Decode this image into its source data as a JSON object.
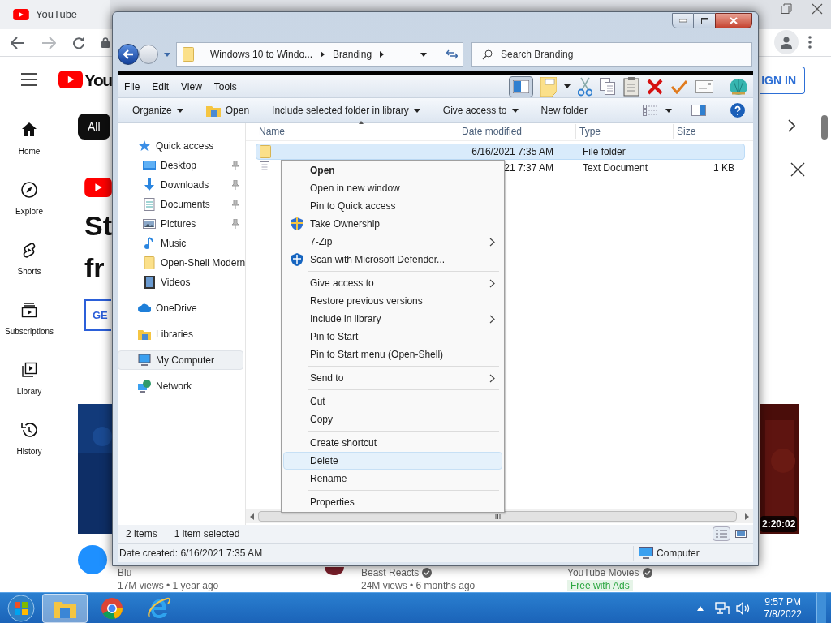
{
  "browser": {
    "tab": {
      "title": "YouTube"
    },
    "logo": "You",
    "rail": [
      {
        "label": "Home"
      },
      {
        "label": "Explore"
      },
      {
        "label": "Shorts"
      },
      {
        "label": "Subscriptions"
      },
      {
        "label": "Library"
      },
      {
        "label": "History"
      }
    ],
    "chips": [
      {
        "label": "All",
        "selected": true
      }
    ],
    "banner": {
      "line_1": "St",
      "line_2": "fr",
      "button": "GE"
    },
    "sign_in": "IGN IN",
    "duration": "2:20:02",
    "videos": [
      {
        "channel": "Blu",
        "verified": false,
        "meta": "17M views • 1 year ago"
      },
      {
        "channel": "Beast Reacts",
        "verified": true,
        "meta": "24M views • 6 months ago"
      },
      {
        "channel": "YouTube Movies",
        "verified": true,
        "badge": "Free with Ads"
      }
    ]
  },
  "explorer": {
    "address": [
      "Windows 10 to Windo...",
      "Branding"
    ],
    "search": {
      "placeholder": "Search Branding"
    },
    "menu": [
      "File",
      "Edit",
      "View",
      "Tools"
    ],
    "commands": [
      {
        "label": "Organize",
        "dropdown": true
      },
      {
        "label": "Open",
        "dropdown": false
      },
      {
        "label": "Include selected folder in library",
        "dropdown": true
      },
      {
        "label": "Give access to",
        "dropdown": true
      },
      {
        "label": "New folder",
        "dropdown": false
      }
    ],
    "nav": [
      {
        "label": "Quick access",
        "selected": false,
        "children": [
          {
            "label": "Desktop",
            "pinned": true,
            "selected": false
          },
          {
            "label": "Downloads",
            "pinned": true,
            "selected": false
          },
          {
            "label": "Documents",
            "pinned": true,
            "selected": false
          },
          {
            "label": "Pictures",
            "pinned": true,
            "selected": false
          },
          {
            "label": "Music",
            "pinned": false,
            "selected": false
          },
          {
            "label": "Open-Shell Modern",
            "pinned": false,
            "selected": false
          },
          {
            "label": "Videos",
            "pinned": false,
            "selected": false
          }
        ]
      },
      {
        "label": "OneDrive",
        "selected": false
      },
      {
        "label": "Libraries",
        "selected": false
      },
      {
        "label": "My Computer",
        "selected": true
      },
      {
        "label": "Network",
        "selected": false
      }
    ],
    "columns": [
      "Name",
      "Date modified",
      "Type",
      "Size"
    ],
    "rows": [
      {
        "selected": true,
        "date": "6/16/2021 7:35 AM",
        "type": "File folder"
      },
      {
        "selected": false,
        "date": "21 7:37 AM",
        "type": "Text Document",
        "size": "1 KB"
      }
    ],
    "status": {
      "count": "2 items",
      "selection": "1 item selected"
    },
    "details": {
      "text": "Date created: 6/16/2021 7:35 AM",
      "location": "Computer"
    }
  },
  "context_menu": [
    {
      "kind": "item",
      "label": "Open",
      "bold": true,
      "selected": false
    },
    {
      "kind": "item",
      "label": "Open in new window",
      "selected": false
    },
    {
      "kind": "item",
      "label": "Pin to Quick access",
      "selected": false
    },
    {
      "kind": "item",
      "label": "Take Ownership",
      "selected": false
    },
    {
      "kind": "item",
      "label": "7-Zip",
      "submenu": true,
      "selected": false
    },
    {
      "kind": "item",
      "label": "Scan with Microsoft Defender...",
      "selected": false
    },
    {
      "kind": "separator"
    },
    {
      "kind": "item",
      "label": "Give access to",
      "submenu": true,
      "selected": false
    },
    {
      "kind": "item",
      "label": "Restore previous versions",
      "selected": false
    },
    {
      "kind": "item",
      "label": "Include in library",
      "submenu": true,
      "selected": false
    },
    {
      "kind": "item",
      "label": "Pin to Start",
      "selected": false
    },
    {
      "kind": "item",
      "label": "Pin to Start menu (Open-Shell)",
      "selected": false
    },
    {
      "kind": "separator"
    },
    {
      "kind": "item",
      "label": "Send to",
      "submenu": true,
      "selected": false
    },
    {
      "kind": "separator"
    },
    {
      "kind": "item",
      "label": "Cut",
      "selected": false
    },
    {
      "kind": "item",
      "label": "Copy",
      "selected": false
    },
    {
      "kind": "separator"
    },
    {
      "kind": "item",
      "label": "Create shortcut",
      "selected": false
    },
    {
      "kind": "item",
      "label": "Delete",
      "selected": true
    },
    {
      "kind": "item",
      "label": "Rename",
      "selected": false
    },
    {
      "kind": "separator"
    },
    {
      "kind": "item",
      "label": "Properties",
      "selected": false
    }
  ],
  "taskbar": {
    "apps": [
      {
        "active": true
      },
      {
        "active": false
      },
      {
        "active": false
      }
    ],
    "time": "9:57 PM",
    "date": "7/8/2022"
  }
}
